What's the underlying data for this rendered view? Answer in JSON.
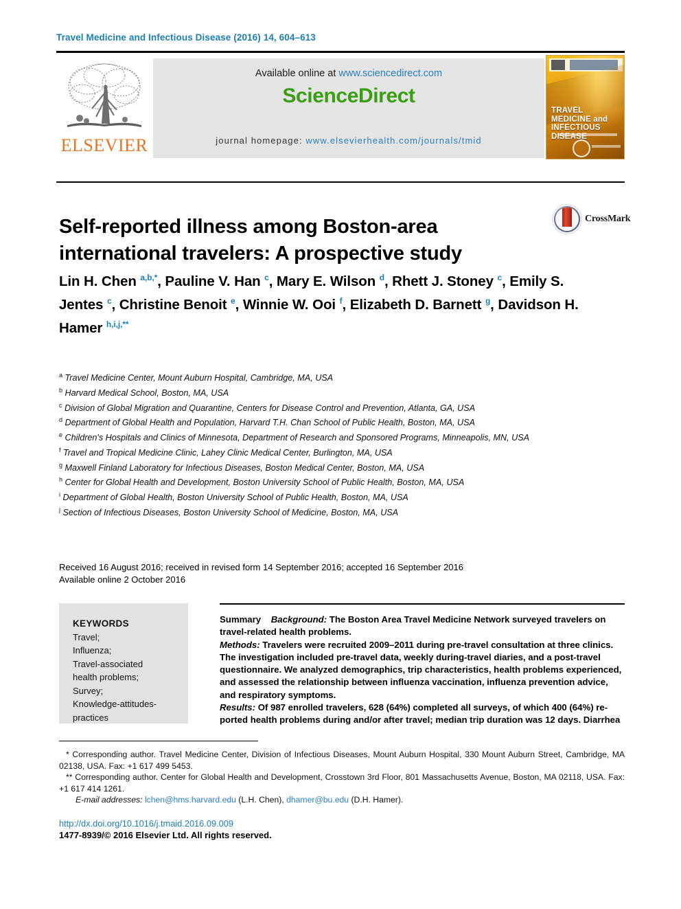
{
  "journal": {
    "running_head": "Travel Medicine and Infectious Disease (2016) 14, 604–613",
    "available_online_label": "Available online at",
    "sciencedirect_url": "www.sciencedirect.com",
    "sciencedirect_logo": "ScienceDirect",
    "homepage_label": "journal homepage:",
    "homepage_url": "www.elsevierhealth.com/journals/tmid",
    "publisher": "ELSEVIER",
    "cover_title": "TRAVEL MEDICINE and INFECTIOUS DISEASE"
  },
  "article": {
    "title": "Self-reported illness among Boston-area international travelers: A prospective study",
    "crossmark_label": "CrossMark",
    "authors_html": "Lin H. Chen <sup>a,b,*</sup>, Pauline V. Han <sup>c</sup>, Mary E. Wilson <sup>d</sup>, Rhett J. Stoney <sup>c</sup>, Emily S. Jentes <sup>c</sup>, Christine Benoit <sup>e</sup>, Winnie W. Ooi <sup>f</sup>, Elizabeth D. Barnett <sup>g</sup>, Davidson H. Hamer <sup>h,i,j,**</sup>",
    "affiliations": [
      {
        "marker": "a",
        "text": "Travel Medicine Center, Mount Auburn Hospital, Cambridge, MA, USA"
      },
      {
        "marker": "b",
        "text": "Harvard Medical School, Boston, MA, USA"
      },
      {
        "marker": "c",
        "text": "Division of Global Migration and Quarantine, Centers for Disease Control and Prevention, Atlanta, GA, USA"
      },
      {
        "marker": "d",
        "text": "Department of Global Health and Population, Harvard T.H. Chan School of Public Health, Boston, MA, USA"
      },
      {
        "marker": "e",
        "text": "Children's Hospitals and Clinics of Minnesota, Department of Research and Sponsored Programs, Minneapolis, MN, USA"
      },
      {
        "marker": "f",
        "text": "Travel and Tropical Medicine Clinic, Lahey Clinic Medical Center, Burlington, MA, USA"
      },
      {
        "marker": "g",
        "text": "Maxwell Finland Laboratory for Infectious Diseases, Boston Medical Center, Boston, MA, USA"
      },
      {
        "marker": "h",
        "text": "Center for Global Health and Development, Boston University School of Public Health, Boston, MA, USA"
      },
      {
        "marker": "i",
        "text": "Department of Global Health, Boston University School of Public Health, Boston, MA, USA"
      },
      {
        "marker": "j",
        "text": "Section of Infectious Diseases, Boston University School of Medicine, Boston, MA, USA"
      }
    ],
    "history_line1": "Received 16 August 2016; received in revised form 14 September 2016; accepted 16 September 2016",
    "history_line2": "Available online 2 October 2016"
  },
  "keywords": {
    "heading": "KEYWORDS",
    "items": [
      "Travel;",
      "Influenza;",
      "Travel-associated",
      "health problems;",
      "Survey;",
      "Knowledge-attitudes-",
      "practices"
    ]
  },
  "summary": {
    "label": "Summary",
    "background_label": "Background:",
    "background_text": "The Boston Area Travel Medicine Network surveyed travelers on travel-related health problems.",
    "methods_label": "Methods:",
    "methods_text": "Travelers were recruited 2009–2011 during pre-travel consultation at three clinics. The investigation included pre-travel data, weekly during-travel diaries, and a post-travel questionnaire. We analyzed demographics, trip characteristics, health problems experienced, and assessed the relationship between influenza vaccination, influenza prevention advice, and respiratory symptoms.",
    "results_label": "Results:",
    "results_text": "Of 987 enrolled travelers, 628 (64%) completed all surveys, of which 400 (64%) re-ported health problems during and/or after travel; median trip duration was 12 days. Diarrhea"
  },
  "footnotes": {
    "corresponding1": "* Corresponding author. Travel Medicine Center, Division of Infectious Diseases, Mount Auburn Hospital, 330 Mount Auburn Street, Cambridge, MA 02138, USA. Fax: +1 617 499 5453.",
    "corresponding2": "** Corresponding author. Center for Global Health and Development, Crosstown 3rd Floor, 801 Massachusetts Avenue, Boston, MA 02118, USA. Fax: +1 617 414 1261.",
    "email_label": "E-mail addresses:",
    "email1": "lchen@hms.harvard.edu",
    "email1_owner": "(L.H. Chen),",
    "email2": "dhamer@bu.edu",
    "email2_owner": "(D.H. Hamer).",
    "doi": "http://dx.doi.org/10.1016/j.tmaid.2016.09.009",
    "copyright": "1477-8939/© 2016 Elsevier Ltd. All rights reserved."
  }
}
